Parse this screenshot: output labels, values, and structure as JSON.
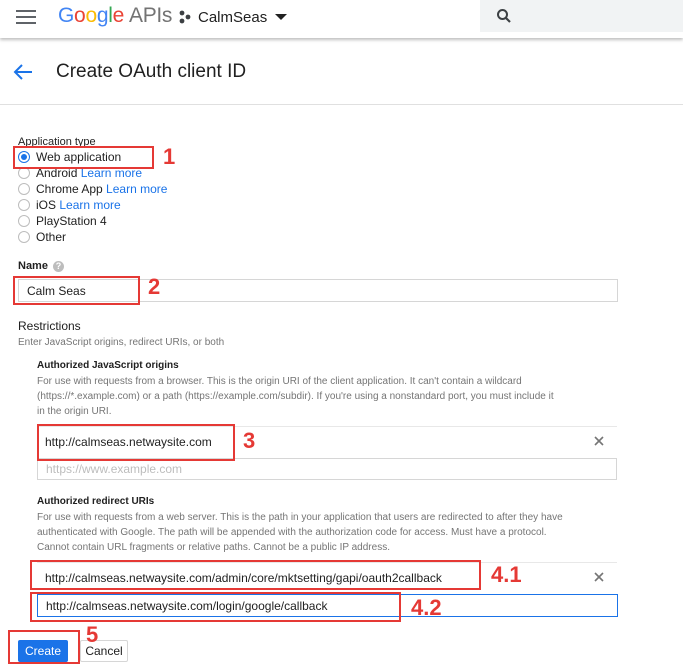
{
  "topbar": {
    "logo_google": "Google",
    "logo_apis": "APIs",
    "project_name": "CalmSeas",
    "logo_colors": [
      "#4285F4",
      "#EA4335",
      "#FBBC05",
      "#4285F4",
      "#34A853",
      "#EA4335"
    ]
  },
  "header": {
    "title": "Create OAuth client ID"
  },
  "app_type": {
    "label": "Application type",
    "options": [
      {
        "label": "Web application",
        "link": "",
        "checked": true
      },
      {
        "label": "Android",
        "link": "Learn more",
        "checked": false
      },
      {
        "label": "Chrome App",
        "link": "Learn more",
        "checked": false
      },
      {
        "label": "iOS",
        "link": "Learn more",
        "checked": false
      },
      {
        "label": "PlayStation 4",
        "link": "",
        "checked": false
      },
      {
        "label": "Other",
        "link": "",
        "checked": false
      }
    ]
  },
  "name": {
    "label": "Name",
    "value": "Calm Seas"
  },
  "restrictions": {
    "heading": "Restrictions",
    "subtext": "Enter JavaScript origins, redirect URIs, or both",
    "js_origins": {
      "title": "Authorized JavaScript origins",
      "desc_1": "For use with requests from a browser. This is the origin URI of the client application. It can't contain a wildcard",
      "desc_2": "(https://*.example.com) or a path (https://example.com/subdir). If you're using a nonstandard port, you must include it",
      "desc_3": "in the origin URI.",
      "uri_1": "http://calmseas.netwaysite.com",
      "placeholder": "https://www.example.com"
    },
    "redirect_uris": {
      "title": "Authorized redirect URIs",
      "desc_1": "For use with requests from a web server. This is the path in your application that users are redirected to after they have",
      "desc_2": "authenticated with Google. The path will be appended with the authorization code for access. Must have a protocol.",
      "desc_3": "Cannot contain URL fragments or relative paths. Cannot be a public IP address.",
      "uri_1": "http://calmseas.netwaysite.com/admin/core/mktsetting/gapi/oauth2callback",
      "uri_2": "http://calmseas.netwaysite.com/login/google/callback"
    }
  },
  "buttons": {
    "create": "Create",
    "cancel": "Cancel"
  },
  "annotations": {
    "n1": "1",
    "n2": "2",
    "n3": "3",
    "n41": "4.1",
    "n42": "4.2",
    "n5": "5",
    "color": "#e53935"
  }
}
